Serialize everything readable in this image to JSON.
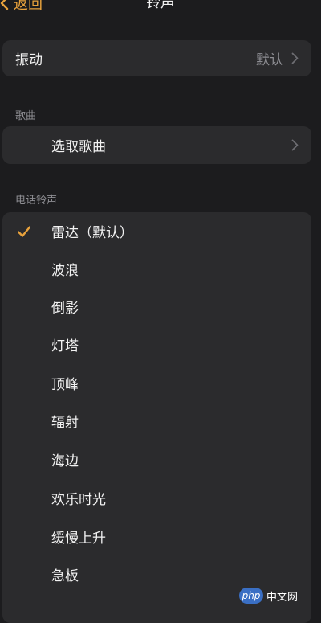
{
  "nav": {
    "back_label": "返回",
    "title": "铃声"
  },
  "vibration": {
    "label": "振动",
    "value": "默认"
  },
  "songs": {
    "section_label": "歌曲",
    "pick_label": "选取歌曲"
  },
  "ringtones": {
    "section_label": "电话铃声",
    "selected_index": 0,
    "items": [
      {
        "label": "雷达（默认）",
        "selected": true
      },
      {
        "label": "波浪",
        "selected": false
      },
      {
        "label": "倒影",
        "selected": false
      },
      {
        "label": "灯塔",
        "selected": false
      },
      {
        "label": "顶峰",
        "selected": false
      },
      {
        "label": "辐射",
        "selected": false
      },
      {
        "label": "海边",
        "selected": false
      },
      {
        "label": "欢乐时光",
        "selected": false
      },
      {
        "label": "缓慢上升",
        "selected": false
      },
      {
        "label": "急板",
        "selected": false
      }
    ]
  },
  "watermark": {
    "badge": "php",
    "text": "中文网"
  },
  "colors": {
    "accent": "#e8a23c",
    "background": "#1c1c1e",
    "cell": "#2b2b2d",
    "secondary_text": "#8e8e93"
  },
  "icons": {
    "back": "chevron-left-icon",
    "disclosure": "chevron-right-icon",
    "selected": "checkmark-icon"
  }
}
